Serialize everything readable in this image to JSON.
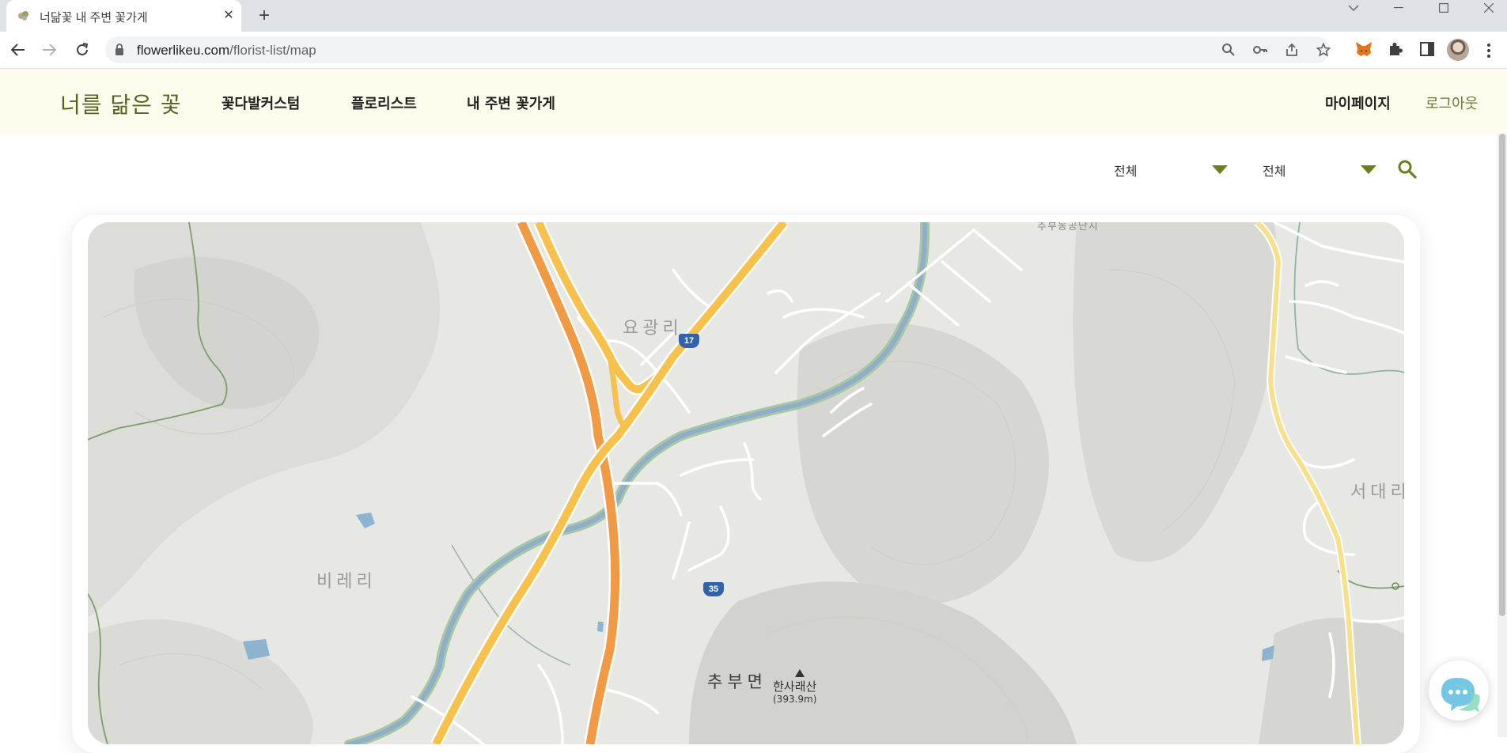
{
  "browser": {
    "tab_title": "너닮꽃 내 주변 꽃가게",
    "url_host": "flowerlikeu.com",
    "url_path": "/florist-list/map"
  },
  "site": {
    "logo": "너를 닮은 꽃",
    "nav": [
      "꽃다발커스텀",
      "플로리스트",
      "내 주변 꽃가게"
    ],
    "mypage": "마이페이지",
    "logout": "로그아웃"
  },
  "filters": {
    "region": "전체",
    "district": "전체"
  },
  "map": {
    "labels": {
      "yogwang": "요광리",
      "birae": "비레리",
      "chubu": "추부면",
      "seodae": "서대리",
      "complex": "추부농공단지",
      "peak_name": "한사래산",
      "peak_elev": "(393.9m)",
      "route17": "17",
      "route35": "35"
    }
  },
  "colors": {
    "header_bg": "#fdfbeb",
    "accent": "#6b7f1e",
    "logo": "#5b6121"
  }
}
